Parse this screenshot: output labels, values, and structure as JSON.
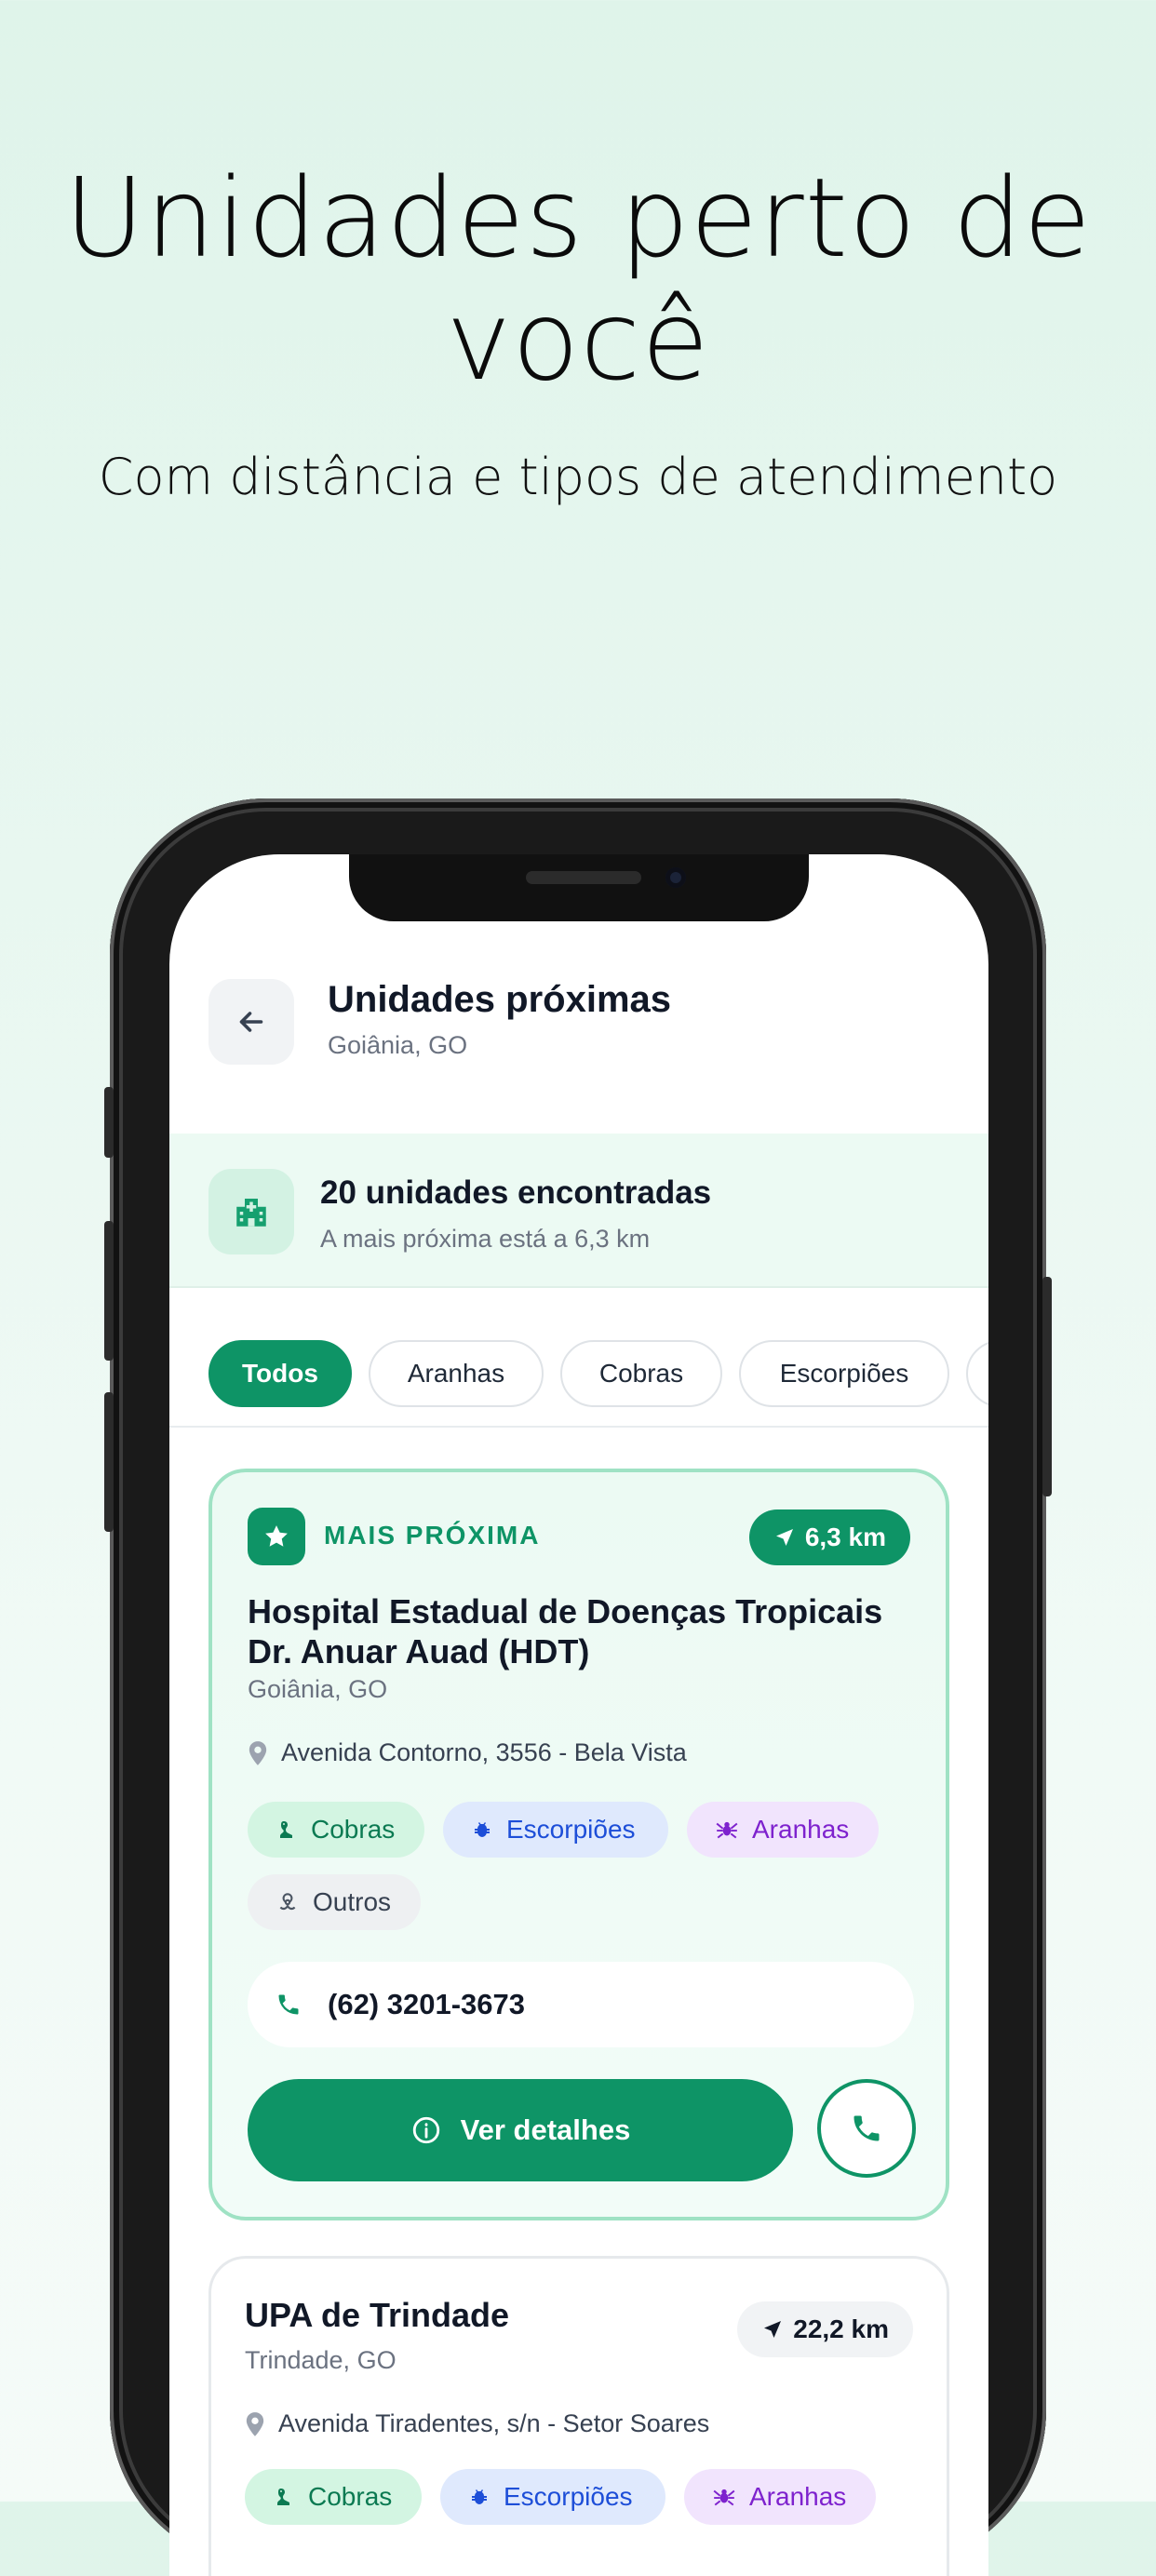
{
  "hero": {
    "title": "Unidades perto de você",
    "subtitle": "Com distância e tipos de atendimento"
  },
  "header": {
    "title": "Unidades próximas",
    "location": "Goiânia, GO",
    "back_icon": "arrow-left-icon"
  },
  "summary": {
    "title": "20 unidades encontradas",
    "subtitle": "A mais próxima está a 6,3 km",
    "icon": "hospital-icon"
  },
  "filters": {
    "active": "Todos",
    "items": [
      "Todos",
      "Aranhas",
      "Cobras",
      "Escorpiões"
    ]
  },
  "cards": [
    {
      "badge": "MAIS PRÓXIMA",
      "distance": "6,3 km",
      "name": "Hospital Estadual de Doenças Tropicais Dr. Anuar Auad (HDT)",
      "city": "Goiânia, GO",
      "address": "Avenida Contorno, 3556 - Bela Vista",
      "tags": [
        "Cobras",
        "Escorpiões",
        "Aranhas",
        "Outros"
      ],
      "phone": "(62) 3201-3673",
      "details_label": "Ver detalhes"
    },
    {
      "distance": "22,2 km",
      "name": "UPA de Trindade",
      "city": "Trindade, GO",
      "address": "Avenida Tiradentes, s/n - Setor Soares",
      "tags": [
        "Cobras",
        "Escorpiões",
        "Aranhas"
      ]
    }
  ],
  "colors": {
    "accent": "#0e9466",
    "tag_green": "#d3f5e2",
    "tag_blue": "#dfe9fd",
    "tag_purple": "#f1e4fd",
    "tag_gray": "#eef0f2"
  }
}
